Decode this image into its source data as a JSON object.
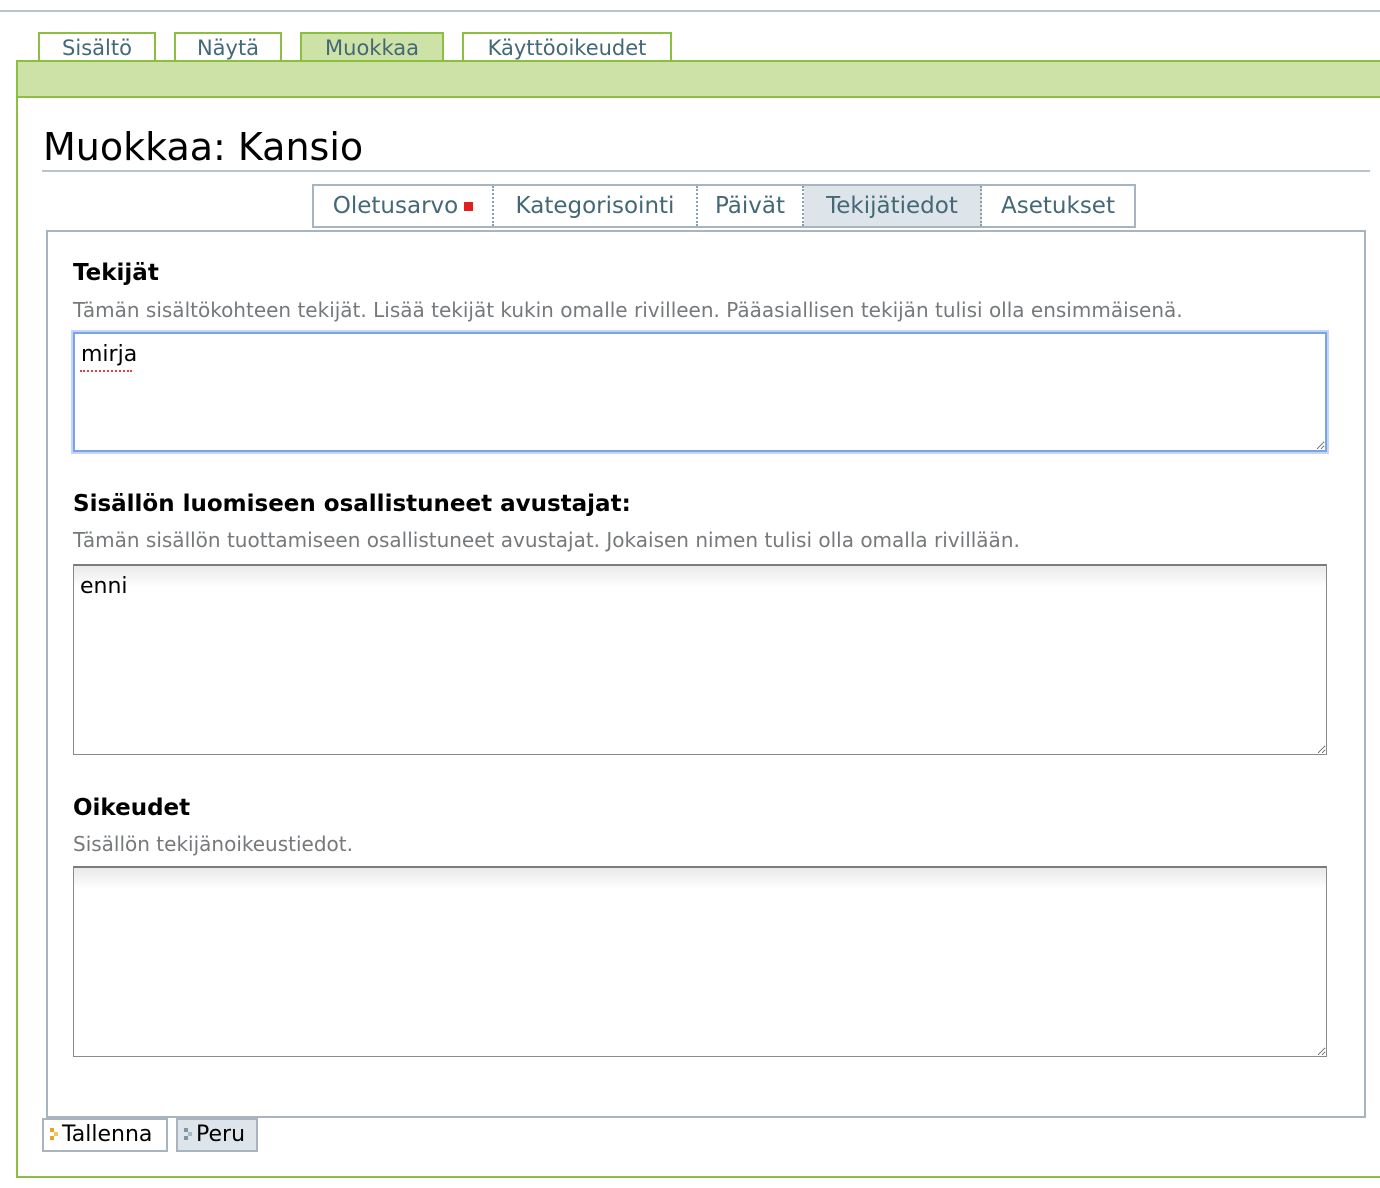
{
  "top_tabs": [
    {
      "label": "Sisältö",
      "active": false
    },
    {
      "label": "Näytä",
      "active": false
    },
    {
      "label": "Muokkaa",
      "active": true
    },
    {
      "label": "Käyttöoikeudet",
      "active": false
    }
  ],
  "page": {
    "title": "Muokkaa: Kansio"
  },
  "form_tabs": [
    {
      "label": "Oletusarvo",
      "active": false,
      "required": true
    },
    {
      "label": "Kategorisointi",
      "active": false
    },
    {
      "label": "Päivät",
      "active": false
    },
    {
      "label": "Tekijätiedot",
      "active": true
    },
    {
      "label": "Asetukset",
      "active": false
    }
  ],
  "fields": {
    "creators": {
      "label": "Tekijät",
      "help": "Tämän sisältökohteen tekijät. Lisää tekijät kukin omalle rivilleen. Pääasiallisen tekijän tulisi olla ensimmäisenä.",
      "value": "mirja"
    },
    "contributors": {
      "label": "Sisällön luomiseen osallistuneet avustajat:",
      "help": "Tämän sisällön tuottamiseen osallistuneet avustajat. Jokaisen nimen tulisi olla omalla rivillään.",
      "value": "enni"
    },
    "rights": {
      "label": "Oikeudet",
      "help": "Sisällön tekijänoikeustiedot.",
      "value": ""
    }
  },
  "buttons": {
    "save_label": "Tallenna",
    "cancel_label": "Peru"
  },
  "colors": {
    "accent_green": "#8cbf3f",
    "tab_green": "#cde2a7",
    "link_blue": "#436976",
    "required_red": "#e02020"
  }
}
